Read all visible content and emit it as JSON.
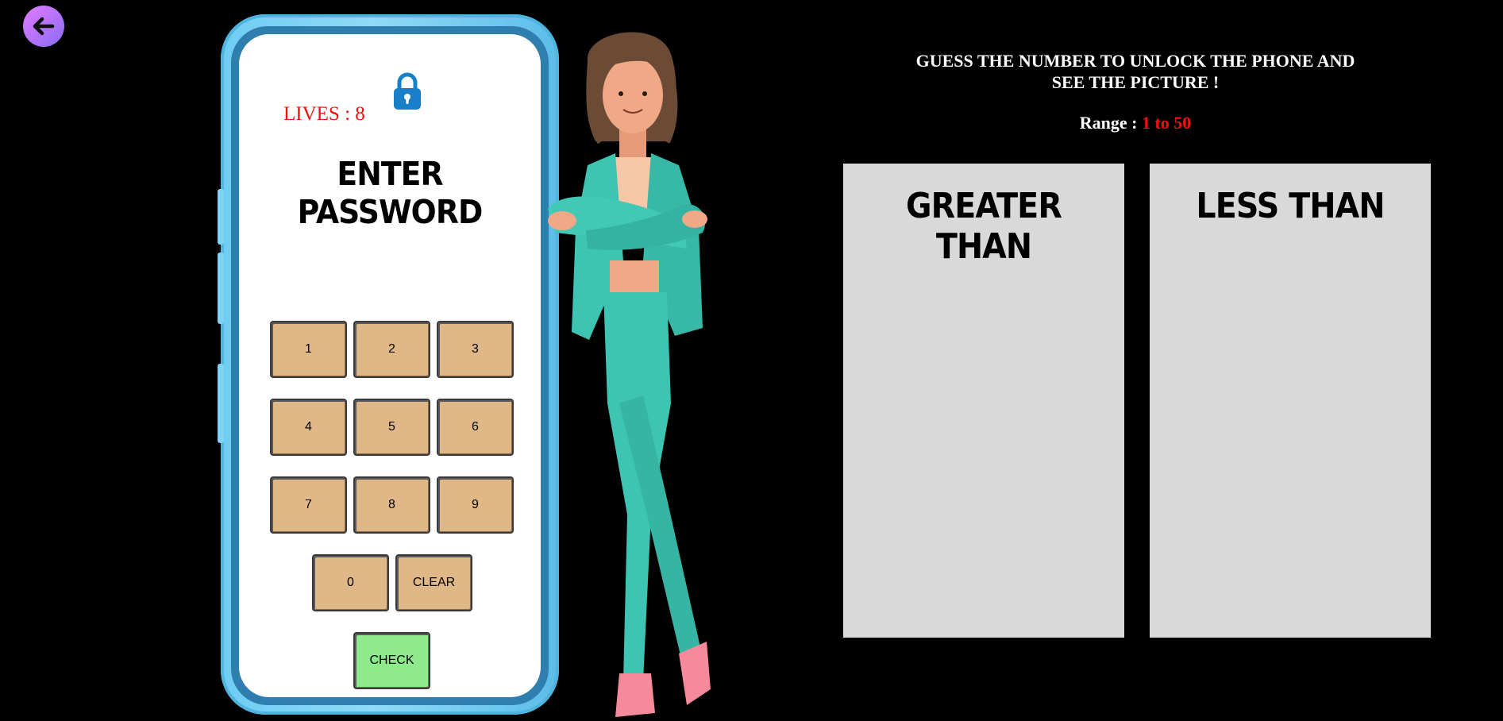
{
  "nav": {
    "back_icon": "arrow-left-icon",
    "accent_color": "#a66ff8"
  },
  "phone": {
    "lock_icon": "padlock-icon",
    "lives_label": "LIVES : ",
    "lives_value": "8",
    "title": "ENTER PASSWORD",
    "keys": [
      "1",
      "2",
      "3",
      "4",
      "5",
      "6",
      "7",
      "8",
      "9",
      "0"
    ],
    "clear_label": "CLEAR",
    "check_label": "CHECK",
    "frame_color": "#6ecdf3",
    "key_color": "#e0b888",
    "check_color": "#8eea8c"
  },
  "game": {
    "instructions_line1": "GUESS THE NUMBER TO UNLOCK THE PHONE AND",
    "instructions_line2": "SEE THE PICTURE !",
    "range_label": "Range : ",
    "range_value": "1 to 50",
    "greater_title": "GREATER THAN",
    "less_title": "LESS THAN",
    "greater_list": [],
    "less_list": []
  }
}
